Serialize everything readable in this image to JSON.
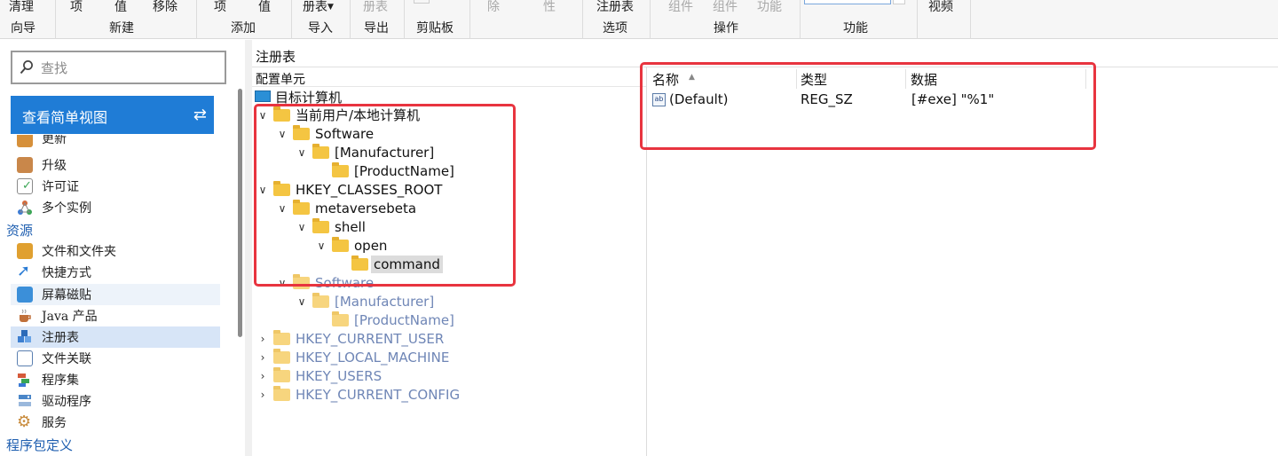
{
  "ribbon": {
    "top_labels": [
      {
        "text": "清理",
        "dim": false
      },
      {
        "text": "项",
        "dim": false
      },
      {
        "text": "值",
        "dim": false
      },
      {
        "text": "移除",
        "dim": false
      },
      {
        "text": "项",
        "dim": false
      },
      {
        "text": "值",
        "dim": false
      },
      {
        "text": "册表",
        "dim": false
      },
      {
        "text": "册表",
        "dim": true
      },
      {
        "text": "除",
        "dim": true
      },
      {
        "text": "性",
        "dim": true
      },
      {
        "text": "注册表",
        "dim": false
      },
      {
        "text": "组件",
        "dim": true
      },
      {
        "text": "组件",
        "dim": true
      },
      {
        "text": "功能",
        "dim": true
      },
      {
        "text": "视频",
        "dim": false
      }
    ],
    "groups": [
      "向导",
      "新建",
      "添加",
      "导入",
      "导出",
      "剪贴板",
      "选项",
      "操作",
      "功能"
    ]
  },
  "leftnav": {
    "search_placeholder": "查找",
    "simple_view_label": "查看简单视图",
    "items": [
      {
        "label": "更新",
        "icon": "update-icon",
        "color": "#d6903a"
      },
      {
        "label": "升级",
        "icon": "upgrade-box-icon",
        "color": "#c9874a"
      },
      {
        "label": "许可证",
        "icon": "license-check-icon",
        "color": "#3aa655"
      },
      {
        "label": "多个实例",
        "icon": "instances-icon",
        "color": "#d46a3a"
      },
      {
        "label": "文件和文件夹",
        "icon": "files-folders-icon",
        "color": "#e0a030"
      },
      {
        "label": "快捷方式",
        "icon": "shortcut-arrow-icon",
        "color": "#2a7bd4"
      },
      {
        "label": "屏幕磁贴",
        "icon": "screen-tiles-icon",
        "color": "#3b8fd9"
      },
      {
        "label": "Java 产品",
        "icon": "java-cup-icon",
        "color": "#c0703a"
      },
      {
        "label": "注册表",
        "icon": "registry-cubes-icon",
        "color": "#3d7fd0"
      },
      {
        "label": "文件关联",
        "icon": "file-association-icon",
        "color": "#5a7fb0"
      },
      {
        "label": "程序集",
        "icon": "assemblies-icon",
        "color": "#d55a3a"
      },
      {
        "label": "驱动程序",
        "icon": "drivers-icon",
        "color": "#4a86c8"
      },
      {
        "label": "服务",
        "icon": "services-gear-icon",
        "color": "#c88a3a"
      }
    ],
    "section_resources": "资源",
    "section_package": "程序包定义"
  },
  "main": {
    "title": "注册表",
    "tree_header": "配置单元",
    "root_label": "目标计算机",
    "tree": [
      {
        "label": "当前用户/本地计算机",
        "chev": "∨",
        "dim": false
      },
      {
        "label": "Software",
        "chev": "∨",
        "dim": false
      },
      {
        "label": "[Manufacturer]",
        "chev": "∨",
        "dim": false
      },
      {
        "label": "[ProductName]",
        "chev": "",
        "dim": false
      },
      {
        "label": "HKEY_CLASSES_ROOT",
        "chev": "∨",
        "dim": false
      },
      {
        "label": "metaversebeta",
        "chev": "∨",
        "dim": false
      },
      {
        "label": "shell",
        "chev": "∨",
        "dim": false
      },
      {
        "label": "open",
        "chev": "∨",
        "dim": false
      },
      {
        "label": "command",
        "chev": "",
        "dim": false
      },
      {
        "label": "Software",
        "chev": "∨",
        "dim": true
      },
      {
        "label": "[Manufacturer]",
        "chev": "∨",
        "dim": true
      },
      {
        "label": "[ProductName]",
        "chev": "",
        "dim": true
      },
      {
        "label": "HKEY_CURRENT_USER",
        "chev": "›",
        "dim": true
      },
      {
        "label": "HKEY_LOCAL_MACHINE",
        "chev": "›",
        "dim": true
      },
      {
        "label": "HKEY_USERS",
        "chev": "›",
        "dim": true
      },
      {
        "label": "HKEY_CURRENT_CONFIG",
        "chev": "›",
        "dim": true
      }
    ],
    "list": {
      "columns": [
        "名称",
        "类型",
        "数据"
      ],
      "rows": [
        {
          "name": "(Default)",
          "type": "REG_SZ",
          "data": "[#exe] \"%1\"",
          "icon": "string-value-icon"
        }
      ]
    },
    "colors": {
      "annotation": "#e8343f",
      "accent": "#1f7cd6",
      "selected_bg": "#d7e5f7"
    }
  }
}
